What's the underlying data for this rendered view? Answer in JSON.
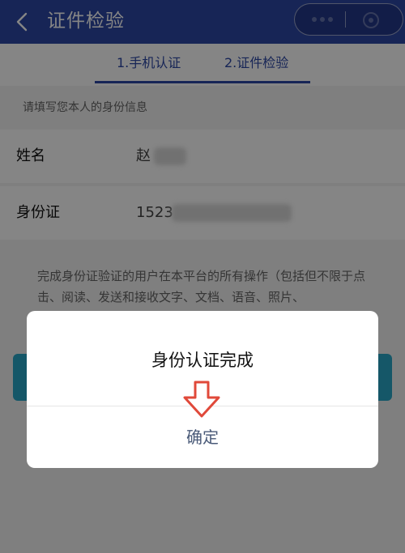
{
  "header": {
    "title": "证件检验",
    "back_icon": "chevron-left-icon",
    "more_icon": "more-dots-icon",
    "close_icon": "close-circle-icon",
    "color": "#2c48a6"
  },
  "tabs": [
    {
      "label": "1.手机认证"
    },
    {
      "label": "2.证件检验"
    }
  ],
  "form": {
    "hint": "请填写您本人的身份信息",
    "name_label": "姓名",
    "name_value": "赵",
    "id_label": "身份证",
    "id_value": "1523"
  },
  "terms": "完成身份证验证的用户在本平台的所有操作（包括但不限于点击、阅读、发送和接收文字、文档、语音、照片、",
  "submit_color": "#2aa7c7",
  "dialog": {
    "title": "身份认证完成",
    "confirm_label": "确定",
    "annotation_icon": "down-arrow-annotation-icon",
    "annotation_color": "#e0493a"
  }
}
